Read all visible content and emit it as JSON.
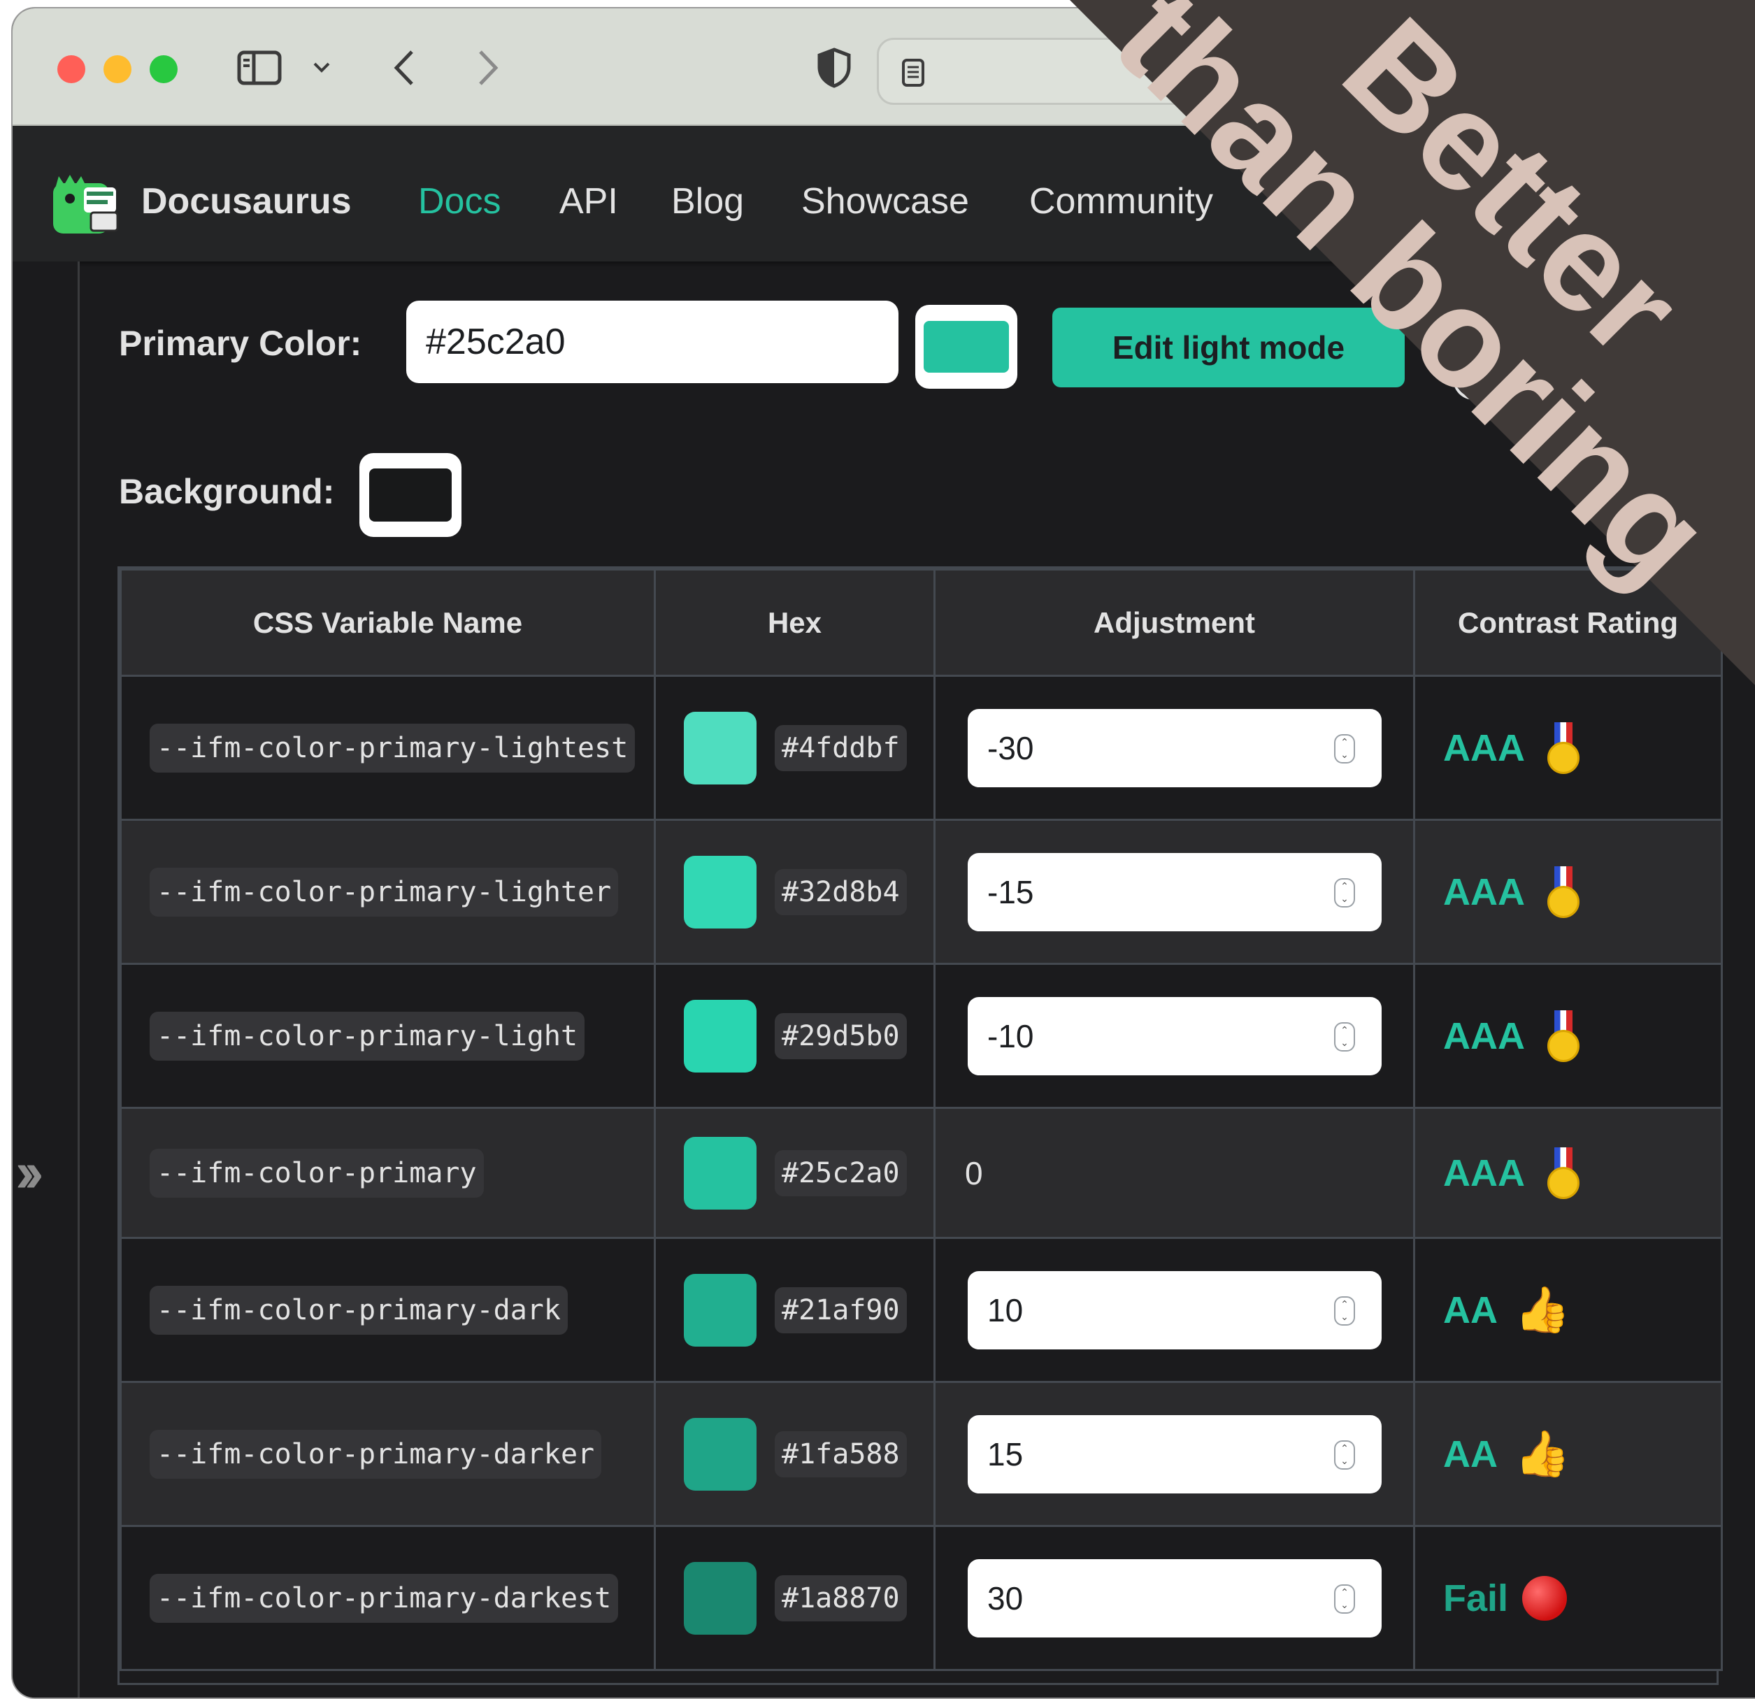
{
  "browser": {
    "traffic_lights": [
      "close",
      "minimize",
      "zoom"
    ],
    "icons": [
      "sidebar-icon",
      "chevron-down-icon",
      "back-icon",
      "forward-icon",
      "shield-icon",
      "reader-icon"
    ]
  },
  "navbar": {
    "brand": "Docusaurus",
    "links": [
      {
        "label": "Docs",
        "active": true
      },
      {
        "label": "API",
        "active": false
      },
      {
        "label": "Blog",
        "active": false
      },
      {
        "label": "Showcase",
        "active": false
      },
      {
        "label": "Community",
        "active": false
      }
    ]
  },
  "controls": {
    "primary_label": "Primary Color:",
    "primary_value": "#25c2a0",
    "primary_color": "#25c2a0",
    "edit_button": "Edit light mode",
    "background_label": "Background:",
    "background_color": "#18191a"
  },
  "table": {
    "headers": [
      "CSS Variable Name",
      "Hex",
      "Adjustment",
      "Contrast Rating"
    ],
    "rows": [
      {
        "name": "--ifm-color-primary-lightest",
        "hex": "#4fddbf",
        "adjustment": "-30",
        "editable": true,
        "rating": "AAA",
        "icon": "medal-icon"
      },
      {
        "name": "--ifm-color-primary-lighter",
        "hex": "#32d8b4",
        "adjustment": "-15",
        "editable": true,
        "rating": "AAA",
        "icon": "medal-icon"
      },
      {
        "name": "--ifm-color-primary-light",
        "hex": "#29d5b0",
        "adjustment": "-10",
        "editable": true,
        "rating": "AAA",
        "icon": "medal-icon"
      },
      {
        "name": "--ifm-color-primary",
        "hex": "#25c2a0",
        "adjustment": "0",
        "editable": false,
        "rating": "AAA",
        "icon": "medal-icon"
      },
      {
        "name": "--ifm-color-primary-dark",
        "hex": "#21af90",
        "adjustment": "10",
        "editable": true,
        "rating": "AA",
        "icon": "thumbs-up-icon"
      },
      {
        "name": "--ifm-color-primary-darker",
        "hex": "#1fa588",
        "adjustment": "15",
        "editable": true,
        "rating": "AA",
        "icon": "thumbs-up-icon"
      },
      {
        "name": "--ifm-color-primary-darkest",
        "hex": "#1a8870",
        "adjustment": "30",
        "editable": true,
        "rating": "Fail",
        "icon": "red-circle-icon"
      }
    ]
  },
  "banner": {
    "line1": "Better",
    "line2": "than boring",
    "color": "#d8c2b8",
    "background": "#403a38"
  }
}
